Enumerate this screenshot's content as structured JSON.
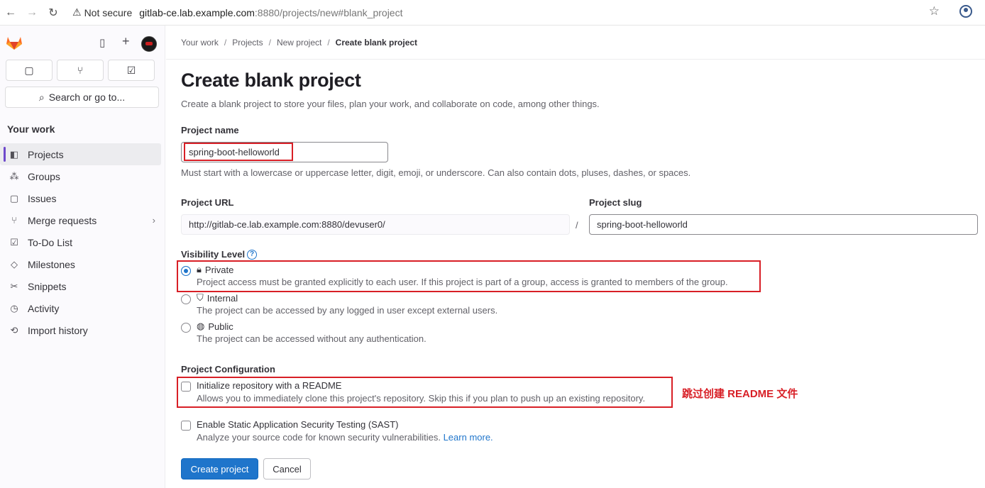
{
  "browser": {
    "security_label": "Not secure",
    "url_host": "gitlab-ce.lab.example.com",
    "url_rest": ":8880/projects/new#blank_project"
  },
  "sidebar": {
    "search_label": "Search or go to...",
    "section_title": "Your work",
    "items": [
      {
        "label": "Projects",
        "icon": "project-icon"
      },
      {
        "label": "Groups",
        "icon": "group-icon"
      },
      {
        "label": "Issues",
        "icon": "issues-icon"
      },
      {
        "label": "Merge requests",
        "icon": "merge-request-icon"
      },
      {
        "label": "To-Do List",
        "icon": "todo-icon"
      },
      {
        "label": "Milestones",
        "icon": "milestone-icon"
      },
      {
        "label": "Snippets",
        "icon": "snippet-icon"
      },
      {
        "label": "Activity",
        "icon": "activity-icon"
      },
      {
        "label": "Import history",
        "icon": "import-history-icon"
      }
    ]
  },
  "breadcrumb": {
    "items": [
      "Your work",
      "Projects",
      "New project",
      "Create blank project"
    ]
  },
  "page": {
    "title": "Create blank project",
    "intro": "Create a blank project to store your files, plan your work, and collaborate on code, among other things.",
    "project_name_label": "Project name",
    "project_name_value": "spring-boot-helloworld",
    "project_name_help": "Must start with a lowercase or uppercase letter, digit, emoji, or underscore. Can also contain dots, pluses, dashes, or spaces.",
    "project_url_label": "Project URL",
    "project_url_value": "http://gitlab-ce.lab.example.com:8880/devuser0/",
    "slash": "/",
    "project_slug_label": "Project slug",
    "project_slug_value": "spring-boot-helloworld",
    "visibility_label": "Visibility Level",
    "visibility": [
      {
        "title": "Private",
        "desc": "Project access must be granted explicitly to each user. If this project is part of a group, access is granted to members of the group.",
        "checked": true
      },
      {
        "title": "Internal",
        "desc": "The project can be accessed by any logged in user except external users.",
        "checked": false
      },
      {
        "title": "Public",
        "desc": "The project can be accessed without any authentication.",
        "checked": false
      }
    ],
    "config_label": "Project Configuration",
    "readme_title": "Initialize repository with a README",
    "readme_desc": "Allows you to immediately clone this project's repository. Skip this if you plan to push up an existing repository.",
    "sast_title": "Enable Static Application Security Testing (SAST)",
    "sast_desc": "Analyze your source code for known security vulnerabilities.",
    "learn_more": "Learn more.",
    "create_button": "Create project",
    "cancel_button": "Cancel",
    "annotation": "跳过创建 README 文件"
  },
  "colors": {
    "accent": "#1f75cb",
    "highlight": "#d81f26",
    "active_indicator": "#6e49cb"
  }
}
